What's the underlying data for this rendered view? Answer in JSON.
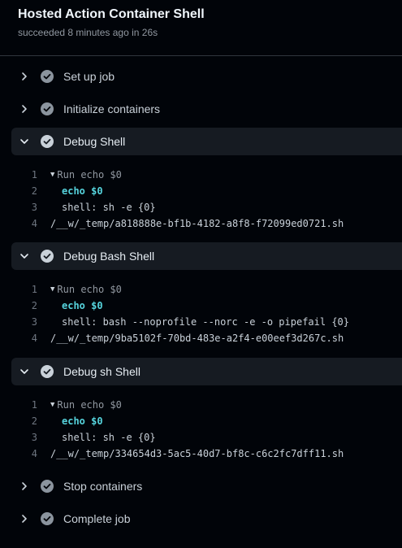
{
  "job": {
    "title": "Hosted Action Container Shell",
    "status": "succeeded 8 minutes ago in 26s"
  },
  "steps": [
    {
      "label": "Set up job"
    },
    {
      "label": "Initialize containers"
    },
    {
      "label": "Debug Shell",
      "lines": [
        {
          "num": "1",
          "text": "Run echo $0"
        },
        {
          "num": "2",
          "text": "echo $0"
        },
        {
          "num": "3",
          "text": "shell: sh -e {0}"
        },
        {
          "num": "4",
          "text": "/__w/_temp/a818888e-bf1b-4182-a8f8-f72099ed0721.sh"
        }
      ]
    },
    {
      "label": "Debug Bash Shell",
      "lines": [
        {
          "num": "1",
          "text": "Run echo $0"
        },
        {
          "num": "2",
          "text": "echo $0"
        },
        {
          "num": "3",
          "text": "shell: bash --noprofile --norc -e -o pipefail {0}"
        },
        {
          "num": "4",
          "text": "/__w/_temp/9ba5102f-70bd-483e-a2f4-e00eef3d267c.sh"
        }
      ]
    },
    {
      "label": "Debug sh Shell",
      "lines": [
        {
          "num": "1",
          "text": "Run echo $0"
        },
        {
          "num": "2",
          "text": "echo $0"
        },
        {
          "num": "3",
          "text": "shell: sh -e {0}"
        },
        {
          "num": "4",
          "text": "/__w/_temp/334654d3-5ac5-40d7-bf8c-c6c2fc7dff11.sh"
        }
      ]
    },
    {
      "label": "Stop containers"
    },
    {
      "label": "Complete job"
    }
  ],
  "icons": {
    "chevron_collapsed": "chevron-right-icon",
    "chevron_expanded": "chevron-down-icon",
    "status": "check-circle-icon"
  },
  "colors": {
    "background": "#010409",
    "expanded_row": "#161b22",
    "keyword": "#56d4dd",
    "check": "#8b949e"
  }
}
